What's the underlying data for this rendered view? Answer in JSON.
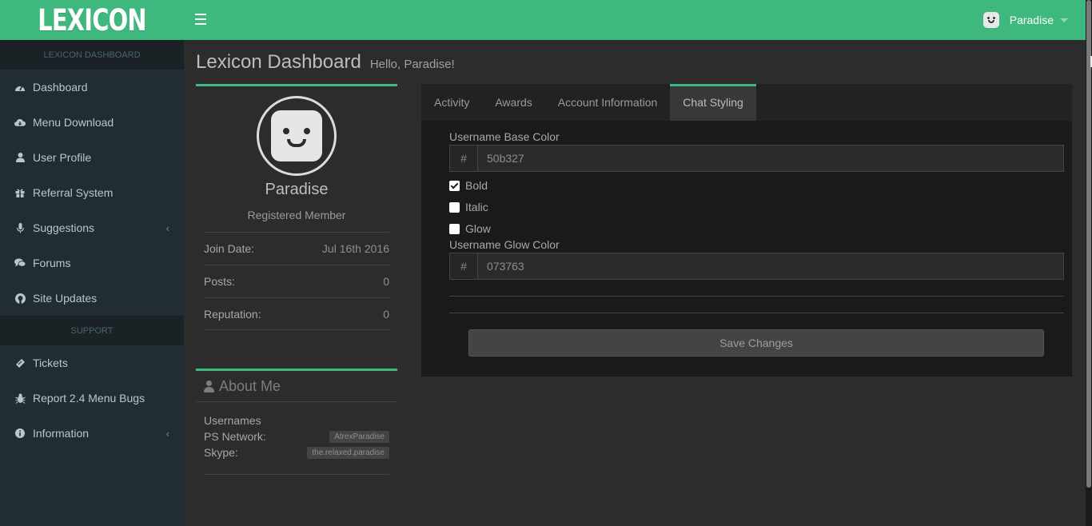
{
  "header": {
    "logo": "LEXICON",
    "username": "Paradise"
  },
  "sidebar": {
    "section_main": "LEXICON DASHBOARD",
    "section_support": "SUPPORT",
    "items": [
      {
        "label": "Dashboard",
        "icon": "dashboard-icon"
      },
      {
        "label": "Menu Download",
        "icon": "cloud-download-icon"
      },
      {
        "label": "User Profile",
        "icon": "user-icon"
      },
      {
        "label": "Referral System",
        "icon": "gift-icon"
      },
      {
        "label": "Suggestions",
        "icon": "microphone-icon"
      },
      {
        "label": "Forums",
        "icon": "comments-icon"
      },
      {
        "label": "Site Updates",
        "icon": "github-icon"
      }
    ],
    "support_items": [
      {
        "label": "Tickets",
        "icon": "ticket-icon"
      },
      {
        "label": "Report 2.4 Menu Bugs",
        "icon": "bug-icon"
      },
      {
        "label": "Information",
        "icon": "info-icon"
      }
    ]
  },
  "page": {
    "title": "Lexicon Dashboard",
    "subtitle": "Hello, Paradise!"
  },
  "profile": {
    "name": "Paradise",
    "role": "Registered Member",
    "join_label": "Join Date:",
    "join_value": "Jul 16th 2016",
    "posts_label": "Posts:",
    "posts_value": "0",
    "rep_label": "Reputation:",
    "rep_value": "0"
  },
  "about": {
    "title": "About Me",
    "usernames_label": "Usernames",
    "psn_label": "PS Network:",
    "psn_value": "AtrexParadise",
    "skype_label": "Skype:",
    "skype_value": "the.relaxed.paradise"
  },
  "tabs": [
    "Activity",
    "Awards",
    "Account Information",
    "Chat Styling"
  ],
  "chat_styling": {
    "base_color_label": "Username Base Color",
    "base_color_value": "50b327",
    "hash": "#",
    "bold_label": "Bold",
    "bold_checked": true,
    "italic_label": "Italic",
    "italic_checked": false,
    "glow_label": "Glow",
    "glow_checked": false,
    "glow_color_label": "Username Glow Color",
    "glow_color_value": "073763",
    "save_label": "Save Changes"
  },
  "colors": {
    "brand": "#3eb87c",
    "sidebar_bg": "#222d32",
    "body_bg": "#2c2c2c"
  }
}
